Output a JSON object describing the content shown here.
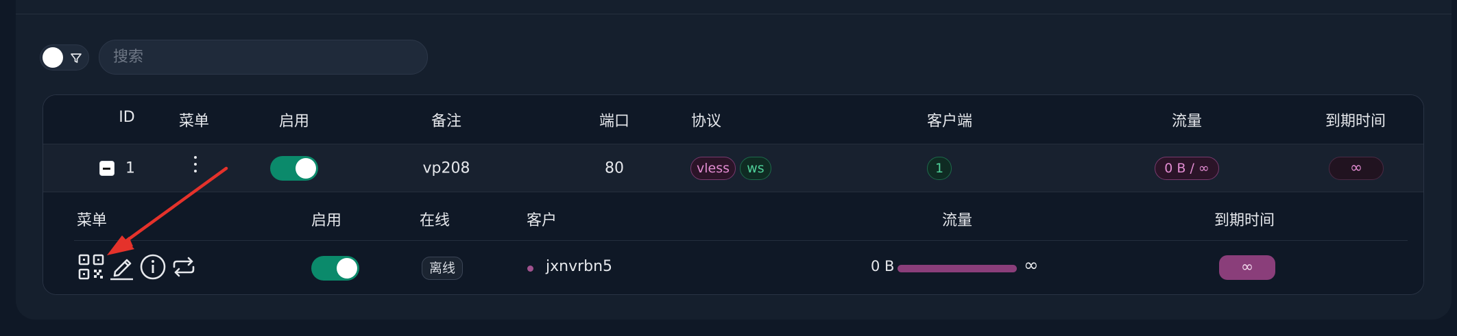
{
  "toolbar": {
    "search_placeholder": "搜索"
  },
  "table": {
    "headers": {
      "id": "ID",
      "menu": "菜单",
      "enable": "启用",
      "remark": "备注",
      "port": "端口",
      "protocol": "协议",
      "clients": "客户端",
      "traffic": "流量",
      "expiry": "到期时间"
    },
    "row": {
      "id": "1",
      "remark": "vp208",
      "port": "80",
      "protocol": "vless",
      "transport": "ws",
      "client_count": "1",
      "traffic": "0 B / ∞",
      "expiry": "∞",
      "enabled": true
    }
  },
  "clients": {
    "headers": {
      "menu": "菜单",
      "enable": "启用",
      "online": "在线",
      "client": "客户",
      "traffic": "流量",
      "expiry": "到期时间"
    },
    "row": {
      "status": "离线",
      "email": "jxnvrbn5",
      "traffic_used": "0 B",
      "traffic_limit": "∞",
      "expiry": "∞",
      "enabled": true
    },
    "action_icons": [
      "qr-code-icon",
      "edit-icon",
      "info-icon",
      "reset-traffic-icon"
    ]
  },
  "colors": {
    "accent_green": "#0b8a6b",
    "accent_purple": "#8a3e7a",
    "annotation_arrow": "#e5322b"
  }
}
